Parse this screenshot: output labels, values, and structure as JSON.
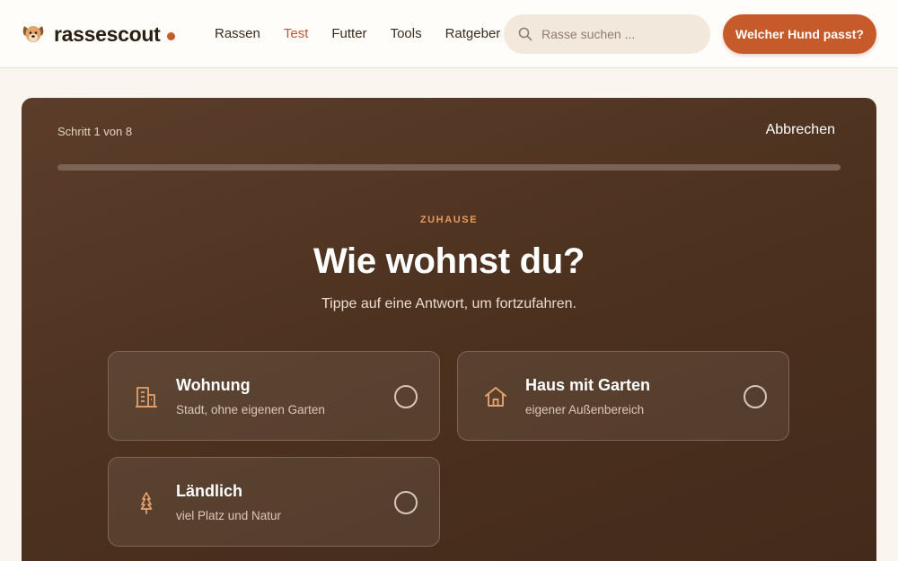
{
  "header": {
    "brand": "rassescout",
    "nav": [
      {
        "label": "Rassen",
        "active": false
      },
      {
        "label": "Test",
        "active": true
      },
      {
        "label": "Futter",
        "active": false
      },
      {
        "label": "Tools",
        "active": false
      },
      {
        "label": "Ratgeber",
        "active": false
      }
    ],
    "search_placeholder": "Rasse suchen ...",
    "cta_label": "Welcher Hund passt?"
  },
  "quiz": {
    "step_label": "Schritt 1 von 8",
    "cancel_label": "Abbrechen",
    "progress_fraction": 0.0,
    "eyebrow": "ZUHAUSE",
    "question": "Wie wohnst du?",
    "hint": "Tippe auf eine Antwort, um fortzufahren.",
    "options": [
      {
        "title": "Wohnung",
        "desc": "Stadt, ohne eigenen Garten",
        "icon": "building-icon"
      },
      {
        "title": "Haus mit Garten",
        "desc": "eigener Außenbereich",
        "icon": "house-icon"
      },
      {
        "title": "Ländlich",
        "desc": "viel Platz und Natur",
        "icon": "tree-icon"
      }
    ]
  },
  "colors": {
    "accent": "#c65a2a",
    "card_bg": "#4b301e",
    "page_bg": "#faf5ef",
    "eyebrow": "#e79a5f"
  }
}
